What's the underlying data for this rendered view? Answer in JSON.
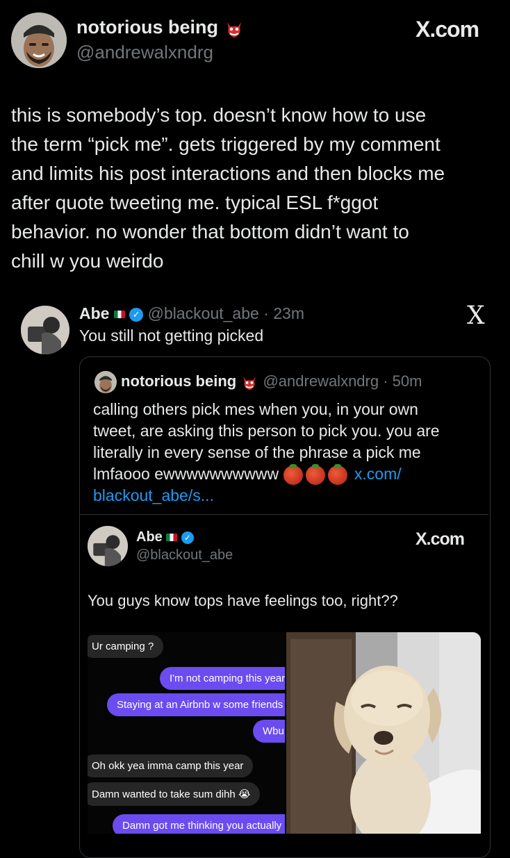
{
  "main_tweet": {
    "display_name": "notorious being",
    "handle": "@andrewalxndrg",
    "source_label": "X.com",
    "text_lines": [
      "this is somebody’s top. doesn’t know how to use",
      "the term “pick me”. gets triggered by my comment",
      "and limits his post interactions and then blocks me",
      "after quote tweeting me. typical ESL f*ggot",
      "behavior. no wonder that bottom didn’t want to",
      "chill w you weirdo"
    ]
  },
  "quoted_tweet": {
    "display_name": "Abe",
    "handle": "@blackout_abe",
    "time": "· 23m",
    "text": "You still not getting picked",
    "x_logo": "X"
  },
  "inner_quote": {
    "display_name": "notorious being",
    "handle": "@andrewalxndrg",
    "time": "· 50m",
    "text_lines": [
      "calling others pick mes when you, in your own",
      "tweet, are asking this person to pick you. you are",
      "literally in every sense of the phrase a pick me"
    ],
    "last_line_text": "lmfaooo ewwwwwwwwww",
    "link_part1": "x.com/",
    "link_part2": "blackout_abe/s..."
  },
  "embedded_tweet": {
    "display_name": "Abe",
    "handle": "@blackout_abe",
    "source_label": "X.com",
    "text": "You guys know tops have feelings too, right??"
  },
  "chat_screenshot": {
    "messages": [
      {
        "side": "in",
        "text": "Ur camping ?"
      },
      {
        "side": "out",
        "text": "I'm not camping this year"
      },
      {
        "side": "out",
        "text": "Staying at an Airbnb w some friends"
      },
      {
        "side": "out",
        "text": "Wbu"
      },
      {
        "side": "in",
        "text": "Oh okk yea imma camp this year"
      },
      {
        "side": "in",
        "text": "Damn wanted to take sum dihh 😭"
      },
      {
        "side": "out",
        "text": "Damn got me thinking you actually"
      }
    ]
  },
  "colors": {
    "background": "#000000",
    "text": "#e7e9ea",
    "muted": "#71767b",
    "link": "#1d9bf0",
    "verified": "#1d9bf0",
    "outgoing_bubble": "#6b4cf0",
    "incoming_bubble": "#262626"
  },
  "icons": [
    "goblin-mask-emoji",
    "mexico-flag-emoji",
    "verified-badge-icon",
    "x-logo-icon",
    "tomato-emoji",
    "loudly-crying-emoji"
  ]
}
